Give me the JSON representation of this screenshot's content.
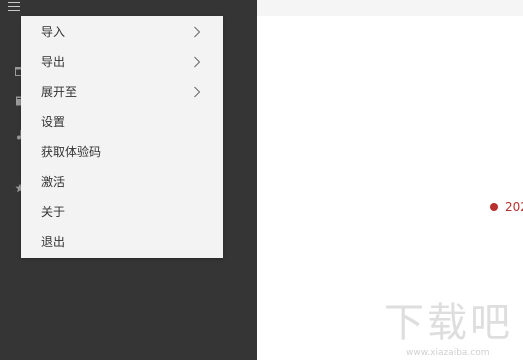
{
  "menu": {
    "items": [
      {
        "label": "导入",
        "has_submenu": true,
        "icon": "chevron-right-icon"
      },
      {
        "label": "导出",
        "has_submenu": true,
        "icon": "chevron-right-icon"
      },
      {
        "label": "展开至",
        "has_submenu": true,
        "icon": "chevron-right-icon"
      },
      {
        "label": "设置",
        "has_submenu": false
      },
      {
        "label": "获取体验码",
        "has_submenu": false
      },
      {
        "label": "激活",
        "has_submenu": false
      },
      {
        "label": "关于",
        "has_submenu": false
      },
      {
        "label": "退出",
        "has_submenu": false
      }
    ]
  },
  "sidebar": {
    "menu_icon": "hamburger-menu-icon",
    "icons": [
      "calendar-icon",
      "book-icon",
      "music-note-icon",
      "star-icon"
    ]
  },
  "timeline": {
    "partial_label": "202",
    "color": "#b8302e"
  },
  "watermark": {
    "text": "下载吧",
    "url": "www.xiazaiba.com"
  },
  "colors": {
    "sidebar_bg": "#353535",
    "menu_bg": "#f3f3f3",
    "accent_red": "#b8302e"
  }
}
